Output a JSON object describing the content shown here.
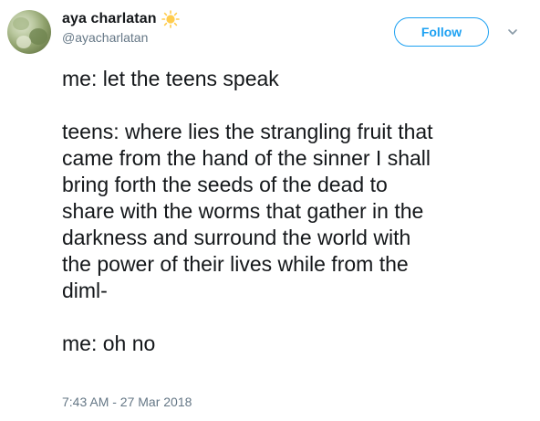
{
  "author": {
    "display_name": "aya charlatan",
    "name_emoji": "sun-icon",
    "handle": "@ayacharlatan",
    "avatar": "avatar-photo"
  },
  "actions": {
    "follow_label": "Follow",
    "menu_icon": "chevron-down-icon"
  },
  "tweet": {
    "lines": [
      "me: let the teens speak",
      "",
      "teens: where lies the strangling fruit that",
      "came from the hand of the sinner I shall",
      "bring forth the seeds of the dead to",
      "share with the worms that gather in the",
      "darkness and surround the world with",
      "the power of their lives while from the",
      "diml-",
      "",
      "me: oh no"
    ],
    "timestamp": "7:43 AM - 27 Mar 2018"
  },
  "colors": {
    "accent": "#1da1f2",
    "text": "#14171a",
    "secondary": "#657786",
    "sun": "#ffcc4d"
  }
}
